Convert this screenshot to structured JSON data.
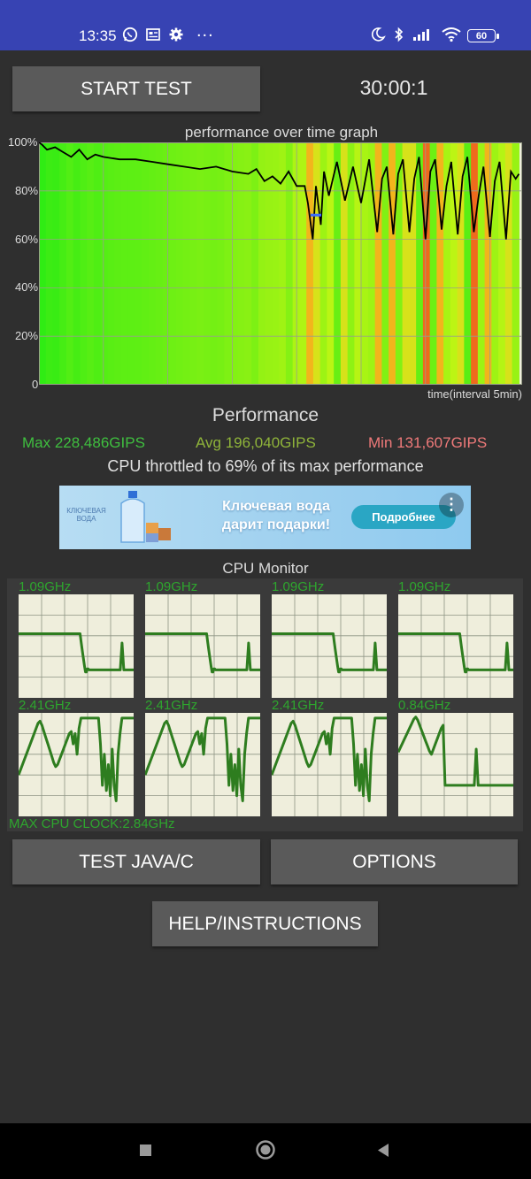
{
  "status_bar": {
    "time": "13:35",
    "more_icons": "...",
    "battery": "60",
    "icons": [
      "whatsapp-icon",
      "news-icon",
      "gear-icon",
      "more-icon",
      "moon-icon",
      "bluetooth-icon",
      "signal-icon",
      "wifi-icon",
      "battery-icon"
    ]
  },
  "controls": {
    "start_label": "START TEST",
    "timer": "30:00:1",
    "java_label": "TEST JAVA/C",
    "options_label": "OPTIONS",
    "help_label": "HELP/INSTRUCTIONS"
  },
  "chart_data": {
    "type": "line",
    "title": "performance over time graph",
    "xlabel": "time(interval 5min)",
    "ylabel": "",
    "ylim": [
      0,
      100
    ],
    "y_ticks": [
      "100%",
      "80%",
      "60%",
      "40%",
      "20%",
      "0"
    ],
    "grid": true,
    "x_range": [
      0,
      30
    ],
    "series": [
      {
        "x": [
          0,
          0.2,
          0.5,
          1,
          1.5,
          2,
          2.5,
          3,
          3.5,
          4,
          5,
          6,
          7,
          8,
          9,
          10,
          11,
          12,
          13,
          13.5,
          14,
          14.5,
          15,
          15.5,
          16,
          16.5,
          16.7,
          17,
          17.2,
          17.5,
          17.7,
          18,
          18.5,
          19,
          19.5,
          20,
          20.5,
          21,
          21.3,
          21.6,
          22,
          22.3,
          22.6,
          23,
          23.3,
          23.6,
          24,
          24.3,
          24.6,
          25,
          25.3,
          25.6,
          26,
          26.3,
          26.6,
          27,
          27.3,
          27.6,
          28,
          28.3,
          28.6,
          29,
          29.3,
          29.6,
          29.8
        ],
        "values": [
          100,
          99,
          97,
          98,
          96,
          94,
          97,
          93,
          95,
          94,
          93,
          93,
          92,
          91,
          90,
          89,
          90,
          88,
          87,
          89,
          84,
          86,
          83,
          88,
          82,
          82,
          75,
          60,
          82,
          66,
          88,
          78,
          92,
          76,
          90,
          75,
          93,
          63,
          85,
          90,
          62,
          87,
          93,
          63,
          85,
          94,
          60,
          88,
          93,
          64,
          82,
          92,
          62,
          86,
          94,
          63,
          78,
          90,
          61,
          84,
          92,
          60,
          88,
          85,
          87
        ]
      }
    ],
    "blue_marker": {
      "x": 17.2,
      "y": 70
    }
  },
  "performance": {
    "title": "Performance",
    "max": "Max 228,486GIPS",
    "avg": "Avg 196,040GIPS",
    "min": "Min 131,607GIPS",
    "throttle": "CPU throttled to 69% of its max performance"
  },
  "ad": {
    "line1": "Ключевая вода",
    "line2": "дарит подарки!",
    "button": "Подробнее",
    "logo": "КЛЮЧЕВАЯ ВОДА",
    "more": "⋮"
  },
  "cpu_monitor": {
    "title": "CPU Monitor",
    "max_clock": "MAX CPU CLOCK:2.84GHz",
    "cores": [
      {
        "freq": "1.09GHz",
        "trace": [
          0.62,
          0.62,
          0.62,
          0.62,
          0.62,
          0.62,
          0.62,
          0.62,
          0.62,
          0.62,
          0.62,
          0.62,
          0.62,
          0.62,
          0.62,
          0.62,
          0.62,
          0.62,
          0.62,
          0.62,
          0.62,
          0.62,
          0.62,
          0.62,
          0.62,
          0.62,
          0.62,
          0.62,
          0.62,
          0.62,
          0.62,
          0.62,
          0.62,
          0.62,
          0.62,
          0.62,
          0.62,
          0.62,
          0.62,
          0.62,
          0.62,
          0.62,
          0.62,
          0.62,
          0.62,
          0.62,
          0.62,
          0.62,
          0.62,
          0.62,
          0.62,
          0.62,
          0.62,
          0.62,
          0.62,
          0.62,
          0.62,
          0.62,
          0.62,
          0.62,
          0.62,
          0.62,
          0.62,
          0.62,
          0.62,
          0.62,
          0.62,
          0.62,
          0.62,
          0.62,
          0.55,
          0.48,
          0.42,
          0.36,
          0.3,
          0.25,
          0.25,
          0.28,
          0.28,
          0.27,
          0.27,
          0.27,
          0.27,
          0.27,
          0.27,
          0.27,
          0.27,
          0.27,
          0.27,
          0.27,
          0.27,
          0.27,
          0.27,
          0.27,
          0.27,
          0.27,
          0.27,
          0.27,
          0.27,
          0.27,
          0.27,
          0.27,
          0.27,
          0.27,
          0.27,
          0.27,
          0.27,
          0.27,
          0.27,
          0.27,
          0.27,
          0.27,
          0.27,
          0.27,
          0.27,
          0.4,
          0.53,
          0.4,
          0.27,
          0.27,
          0.27,
          0.27,
          0.27,
          0.27,
          0.27,
          0.27,
          0.27,
          0.27,
          0.27,
          0.27
        ]
      },
      {
        "freq": "1.09GHz",
        "trace": [
          0.62,
          0.62,
          0.62,
          0.62,
          0.62,
          0.62,
          0.62,
          0.62,
          0.62,
          0.62,
          0.62,
          0.62,
          0.62,
          0.62,
          0.62,
          0.62,
          0.62,
          0.62,
          0.62,
          0.62,
          0.62,
          0.62,
          0.62,
          0.62,
          0.62,
          0.62,
          0.62,
          0.62,
          0.62,
          0.62,
          0.62,
          0.62,
          0.62,
          0.62,
          0.62,
          0.62,
          0.62,
          0.62,
          0.62,
          0.62,
          0.62,
          0.62,
          0.62,
          0.62,
          0.62,
          0.62,
          0.62,
          0.62,
          0.62,
          0.62,
          0.62,
          0.62,
          0.62,
          0.62,
          0.62,
          0.62,
          0.62,
          0.62,
          0.62,
          0.62,
          0.62,
          0.62,
          0.62,
          0.62,
          0.62,
          0.62,
          0.62,
          0.62,
          0.62,
          0.62,
          0.55,
          0.48,
          0.42,
          0.36,
          0.3,
          0.25,
          0.25,
          0.28,
          0.28,
          0.27,
          0.27,
          0.27,
          0.27,
          0.27,
          0.27,
          0.27,
          0.27,
          0.27,
          0.27,
          0.27,
          0.27,
          0.27,
          0.27,
          0.27,
          0.27,
          0.27,
          0.27,
          0.27,
          0.27,
          0.27,
          0.27,
          0.27,
          0.27,
          0.27,
          0.27,
          0.27,
          0.27,
          0.27,
          0.27,
          0.27,
          0.27,
          0.27,
          0.27,
          0.27,
          0.27,
          0.4,
          0.53,
          0.4,
          0.27,
          0.27,
          0.27,
          0.27,
          0.27,
          0.27,
          0.27,
          0.27,
          0.27,
          0.27,
          0.27,
          0.27
        ]
      },
      {
        "freq": "1.09GHz",
        "trace": [
          0.62,
          0.62,
          0.62,
          0.62,
          0.62,
          0.62,
          0.62,
          0.62,
          0.62,
          0.62,
          0.62,
          0.62,
          0.62,
          0.62,
          0.62,
          0.62,
          0.62,
          0.62,
          0.62,
          0.62,
          0.62,
          0.62,
          0.62,
          0.62,
          0.62,
          0.62,
          0.62,
          0.62,
          0.62,
          0.62,
          0.62,
          0.62,
          0.62,
          0.62,
          0.62,
          0.62,
          0.62,
          0.62,
          0.62,
          0.62,
          0.62,
          0.62,
          0.62,
          0.62,
          0.62,
          0.62,
          0.62,
          0.62,
          0.62,
          0.62,
          0.62,
          0.62,
          0.62,
          0.62,
          0.62,
          0.62,
          0.62,
          0.62,
          0.62,
          0.62,
          0.62,
          0.62,
          0.62,
          0.62,
          0.62,
          0.62,
          0.62,
          0.62,
          0.62,
          0.62,
          0.55,
          0.48,
          0.42,
          0.36,
          0.3,
          0.25,
          0.25,
          0.28,
          0.28,
          0.27,
          0.27,
          0.27,
          0.27,
          0.27,
          0.27,
          0.27,
          0.27,
          0.27,
          0.27,
          0.27,
          0.27,
          0.27,
          0.27,
          0.27,
          0.27,
          0.27,
          0.27,
          0.27,
          0.27,
          0.27,
          0.27,
          0.27,
          0.27,
          0.27,
          0.27,
          0.27,
          0.27,
          0.27,
          0.27,
          0.27,
          0.27,
          0.27,
          0.27,
          0.27,
          0.27,
          0.4,
          0.53,
          0.4,
          0.27,
          0.27,
          0.27,
          0.27,
          0.27,
          0.27,
          0.27,
          0.27,
          0.27,
          0.27,
          0.27,
          0.27
        ]
      },
      {
        "freq": "1.09GHz",
        "trace": [
          0.62,
          0.62,
          0.62,
          0.62,
          0.62,
          0.62,
          0.62,
          0.62,
          0.62,
          0.62,
          0.62,
          0.62,
          0.62,
          0.62,
          0.62,
          0.62,
          0.62,
          0.62,
          0.62,
          0.62,
          0.62,
          0.62,
          0.62,
          0.62,
          0.62,
          0.62,
          0.62,
          0.62,
          0.62,
          0.62,
          0.62,
          0.62,
          0.62,
          0.62,
          0.62,
          0.62,
          0.62,
          0.62,
          0.62,
          0.62,
          0.62,
          0.62,
          0.62,
          0.62,
          0.62,
          0.62,
          0.62,
          0.62,
          0.62,
          0.62,
          0.62,
          0.62,
          0.62,
          0.62,
          0.62,
          0.62,
          0.62,
          0.62,
          0.62,
          0.62,
          0.62,
          0.62,
          0.62,
          0.62,
          0.62,
          0.62,
          0.62,
          0.62,
          0.62,
          0.62,
          0.55,
          0.48,
          0.42,
          0.36,
          0.3,
          0.25,
          0.25,
          0.28,
          0.28,
          0.27,
          0.27,
          0.27,
          0.27,
          0.27,
          0.27,
          0.27,
          0.27,
          0.27,
          0.27,
          0.27,
          0.27,
          0.27,
          0.27,
          0.27,
          0.27,
          0.27,
          0.27,
          0.27,
          0.27,
          0.27,
          0.27,
          0.27,
          0.27,
          0.27,
          0.27,
          0.27,
          0.27,
          0.27,
          0.27,
          0.27,
          0.27,
          0.27,
          0.27,
          0.27,
          0.27,
          0.27,
          0.27,
          0.27,
          0.27,
          0.27,
          0.27,
          0.4,
          0.53,
          0.4,
          0.27,
          0.27,
          0.27,
          0.27,
          0.27,
          0.27
        ]
      },
      {
        "freq": "2.41GHz",
        "trace": [
          0.4,
          0.45,
          0.5,
          0.55,
          0.6,
          0.65,
          0.7,
          0.75,
          0.8,
          0.85,
          0.9,
          0.92,
          0.88,
          0.82,
          0.76,
          0.7,
          0.64,
          0.58,
          0.52,
          0.48,
          0.5,
          0.55,
          0.6,
          0.65,
          0.7,
          0.75,
          0.8,
          0.82,
          0.7,
          0.8,
          0.6,
          0.85,
          0.95,
          0.95,
          0.95,
          0.95,
          0.95,
          0.95,
          0.95,
          0.95,
          0.95,
          0.95,
          0.7,
          0.3,
          0.6,
          0.25,
          0.5,
          0.2,
          0.65,
          0.3,
          0.15,
          0.6,
          0.8,
          0.95,
          0.95,
          0.95,
          0.95,
          0.95,
          0.95,
          0.95
        ]
      },
      {
        "freq": "2.41GHz",
        "trace": [
          0.4,
          0.45,
          0.5,
          0.55,
          0.6,
          0.65,
          0.7,
          0.75,
          0.8,
          0.85,
          0.9,
          0.92,
          0.88,
          0.82,
          0.76,
          0.7,
          0.64,
          0.58,
          0.52,
          0.48,
          0.5,
          0.55,
          0.6,
          0.65,
          0.7,
          0.75,
          0.8,
          0.82,
          0.7,
          0.8,
          0.6,
          0.85,
          0.95,
          0.95,
          0.95,
          0.95,
          0.95,
          0.95,
          0.95,
          0.95,
          0.95,
          0.95,
          0.7,
          0.3,
          0.6,
          0.25,
          0.5,
          0.2,
          0.65,
          0.3,
          0.15,
          0.6,
          0.8,
          0.95,
          0.95,
          0.95,
          0.95,
          0.95,
          0.95,
          0.95
        ]
      },
      {
        "freq": "2.41GHz",
        "trace": [
          0.4,
          0.45,
          0.5,
          0.55,
          0.6,
          0.65,
          0.7,
          0.75,
          0.8,
          0.85,
          0.9,
          0.92,
          0.88,
          0.82,
          0.76,
          0.7,
          0.64,
          0.58,
          0.52,
          0.48,
          0.5,
          0.55,
          0.6,
          0.65,
          0.7,
          0.75,
          0.8,
          0.82,
          0.7,
          0.8,
          0.6,
          0.85,
          0.95,
          0.95,
          0.95,
          0.95,
          0.95,
          0.95,
          0.95,
          0.95,
          0.95,
          0.95,
          0.7,
          0.3,
          0.6,
          0.25,
          0.5,
          0.2,
          0.65,
          0.3,
          0.15,
          0.6,
          0.8,
          0.95,
          0.95,
          0.95,
          0.95,
          0.95,
          0.95,
          0.95
        ]
      },
      {
        "freq": "0.84GHz",
        "trace": [
          0.62,
          0.66,
          0.7,
          0.74,
          0.78,
          0.82,
          0.86,
          0.9,
          0.94,
          0.96,
          0.93,
          0.88,
          0.83,
          0.78,
          0.73,
          0.68,
          0.63,
          0.6,
          0.65,
          0.7,
          0.75,
          0.8,
          0.85,
          0.88,
          0.3,
          0.3,
          0.3,
          0.3,
          0.3,
          0.3,
          0.3,
          0.3,
          0.3,
          0.3,
          0.3,
          0.3,
          0.3,
          0.3,
          0.3,
          0.3,
          0.65,
          0.3,
          0.3,
          0.3,
          0.3,
          0.3,
          0.3,
          0.3,
          0.3,
          0.3,
          0.3,
          0.3,
          0.3,
          0.3,
          0.3,
          0.3,
          0.3,
          0.3,
          0.3,
          0.3
        ]
      }
    ]
  },
  "colors": {
    "status_bar": "#3743b3",
    "background": "#2f2f2f",
    "plot_bg": "#efeedc",
    "line_green": "#2ea62e",
    "max_color": "#3fbf3f",
    "avg_color": "#8fb43a",
    "min_color": "#f07a7a"
  }
}
